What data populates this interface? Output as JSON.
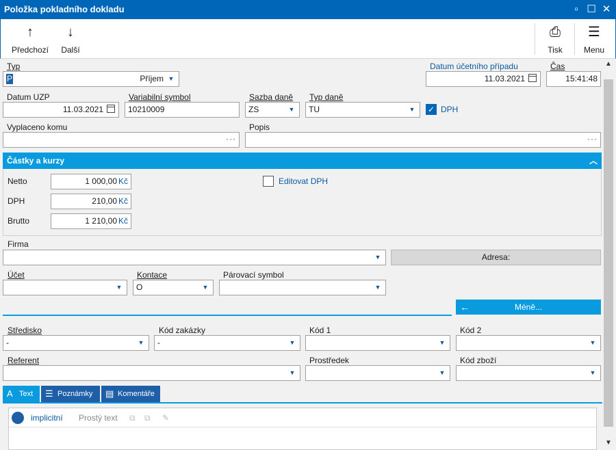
{
  "window": {
    "title": "Položka pokladního dokladu"
  },
  "toolbar": {
    "prev_label": "Předchozí",
    "next_label": "Další",
    "print_label": "Tisk",
    "menu_label": "Menu"
  },
  "fields": {
    "typ": {
      "label": "Typ",
      "value_code": "P",
      "value": "Příjem"
    },
    "datum_ucetniho_pripadu": {
      "label": "Datum účetního případu",
      "value": "11.03.2021"
    },
    "cas": {
      "label": "Čas",
      "value": "15:41:48"
    },
    "datum_uzp": {
      "label": "Datum UZP",
      "value": "11.03.2021"
    },
    "variabilni_symbol": {
      "label": "Variabilní symbol",
      "value": "10210009"
    },
    "sazba_dane": {
      "label": "Sazba daně",
      "value": "ZS"
    },
    "typ_dane": {
      "label": "Typ daně",
      "value": "TU"
    },
    "dph_check": {
      "label": "DPH",
      "checked": true
    },
    "vyplaceno_komu": {
      "label": "Vyplaceno komu",
      "value": ""
    },
    "popis": {
      "label": "Popis",
      "value": ""
    }
  },
  "section": {
    "title": "Částky a kurzy",
    "netto": {
      "label": "Netto",
      "value": "1 000,00",
      "currency": "Kč"
    },
    "dph": {
      "label": "DPH",
      "value": "210,00",
      "currency": "Kč"
    },
    "brutto": {
      "label": "Brutto",
      "value": "1 210,00",
      "currency": "Kč"
    },
    "editovat_dph": {
      "label": "Editovat DPH",
      "checked": false
    }
  },
  "firma": {
    "label": "Firma",
    "value": ""
  },
  "adresa_label": "Adresa:",
  "ucet": {
    "label": "Účet",
    "value": ""
  },
  "kontace": {
    "label": "Kontace",
    "value": "O"
  },
  "parovaci_symbol": {
    "label": "Párovací symbol",
    "value": ""
  },
  "mene_label": "Méně...",
  "stredisko": {
    "label": "Středisko",
    "value": "-"
  },
  "kod_zakazky": {
    "label": "Kód zakázky",
    "value": "-"
  },
  "kod1": {
    "label": "Kód 1",
    "value": ""
  },
  "kod2": {
    "label": "Kód 2",
    "value": ""
  },
  "referent": {
    "label": "Referent",
    "value": ""
  },
  "prostredek": {
    "label": "Prostředek",
    "value": ""
  },
  "kod_zbozi": {
    "label": "Kód zboží",
    "value": ""
  },
  "tabs": [
    {
      "label": "Text"
    },
    {
      "label": "Poznámky"
    },
    {
      "label": "Komentáře"
    }
  ],
  "editor": {
    "lang": "implicitní",
    "format": "Prostý text"
  }
}
